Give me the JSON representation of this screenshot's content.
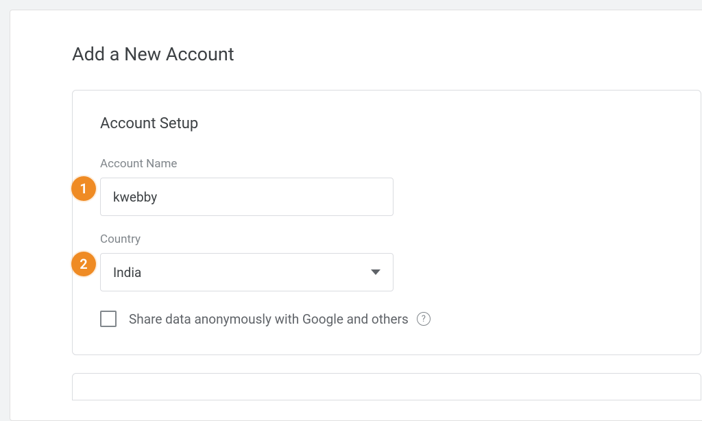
{
  "page": {
    "title": "Add a New Account"
  },
  "setup": {
    "sectionTitle": "Account Setup",
    "accountName": {
      "label": "Account Name",
      "value": "kwebby"
    },
    "country": {
      "label": "Country",
      "selected": "India"
    },
    "shareData": {
      "label": "Share data anonymously with Google and others",
      "checked": false
    }
  },
  "annotations": {
    "step1": "1",
    "step2": "2"
  },
  "help": {
    "glyph": "?"
  }
}
